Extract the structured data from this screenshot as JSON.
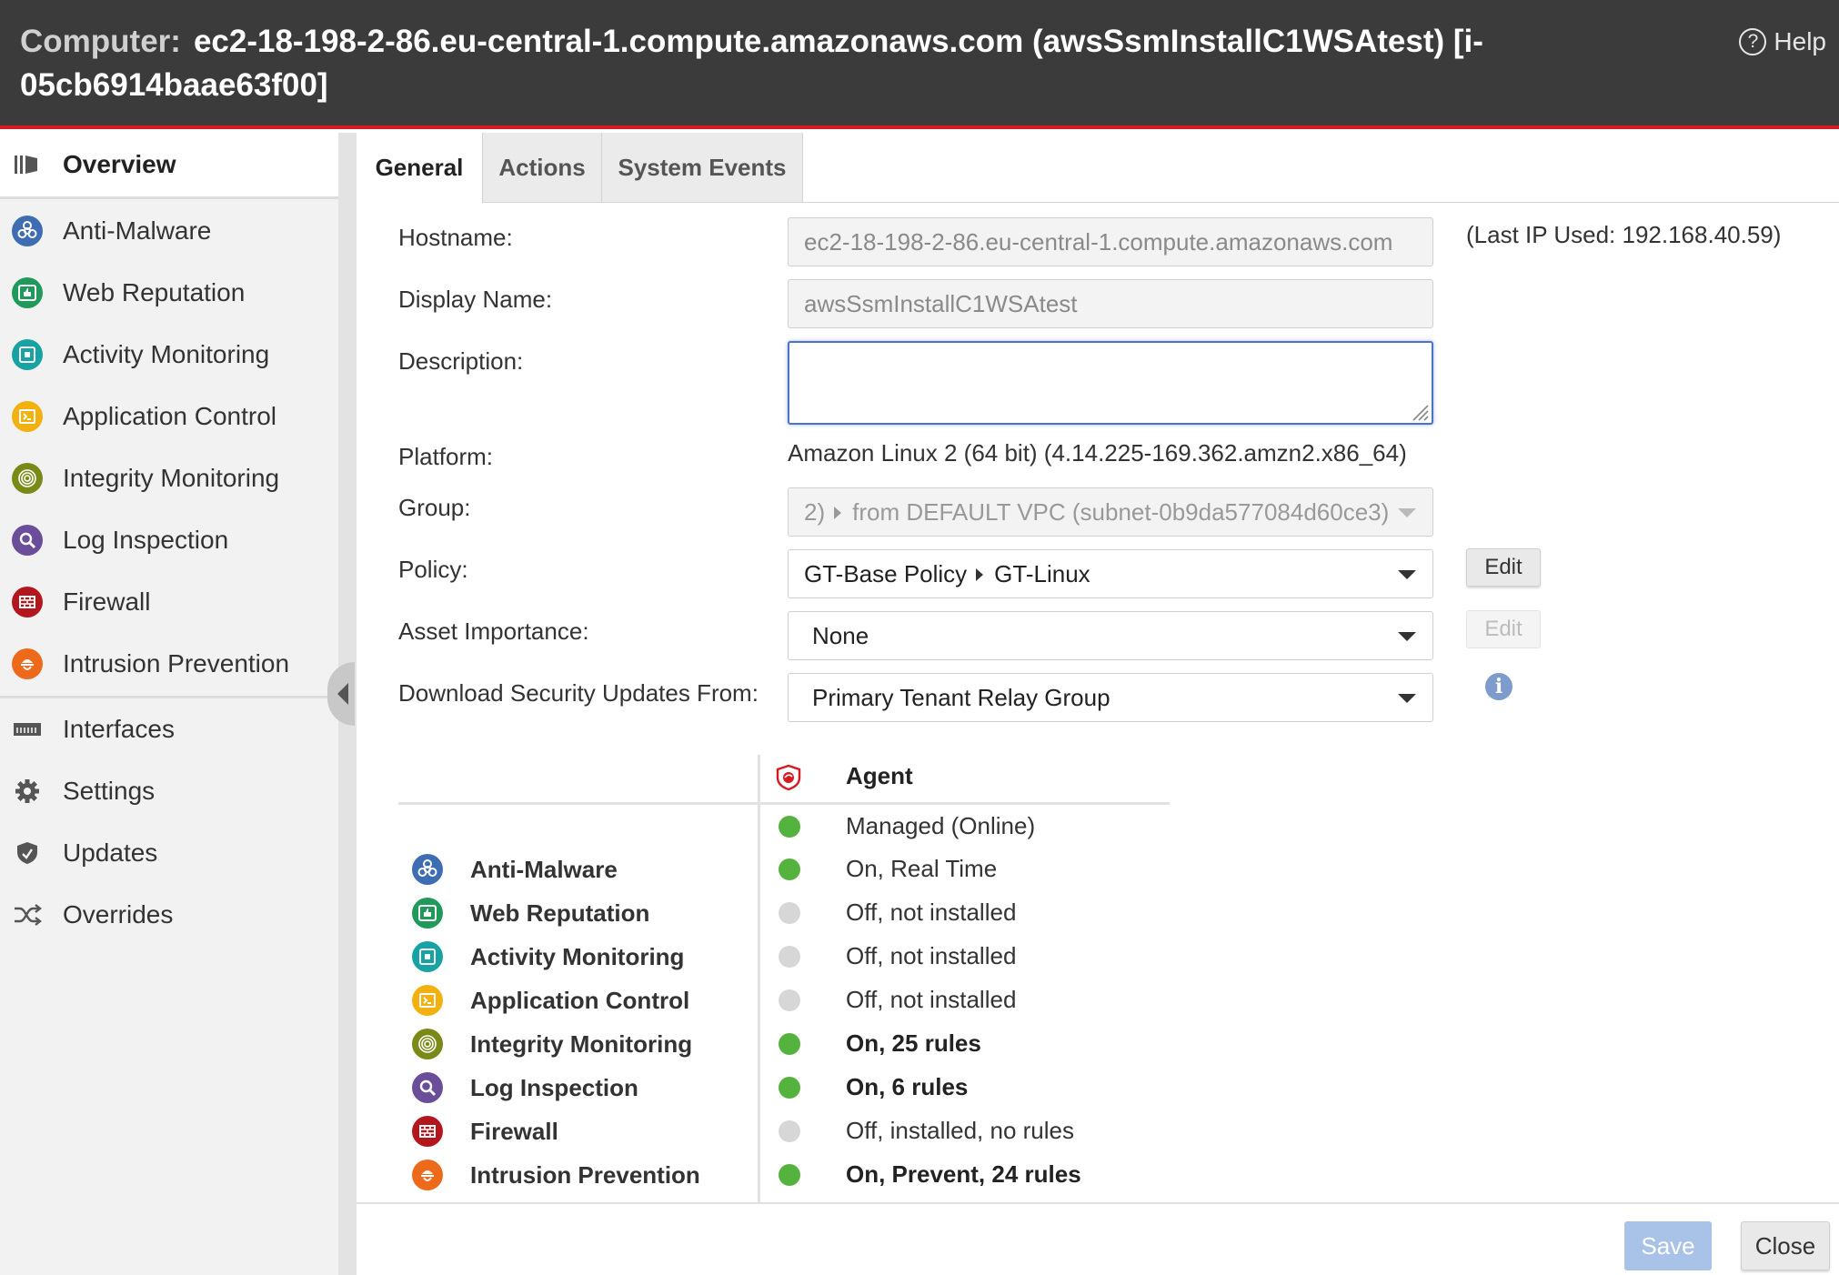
{
  "header": {
    "prefix": "Computer:",
    "title": "ec2-18-198-2-86.eu-central-1.compute.amazonaws.com (awsSsmInstallC1WSAtest) [i-05cb6914baae63f00]",
    "help_label": "Help"
  },
  "sidebar": {
    "items": [
      {
        "label": "Overview",
        "icon": "overview-icon"
      },
      {
        "label": "Anti-Malware",
        "icon": "biohazard-icon"
      },
      {
        "label": "Web Reputation",
        "icon": "web-reputation-icon"
      },
      {
        "label": "Activity Monitoring",
        "icon": "activity-monitoring-icon"
      },
      {
        "label": "Application Control",
        "icon": "terminal-icon"
      },
      {
        "label": "Integrity Monitoring",
        "icon": "fingerprint-icon"
      },
      {
        "label": "Log Inspection",
        "icon": "magnifier-icon"
      },
      {
        "label": "Firewall",
        "icon": "firewall-icon"
      },
      {
        "label": "Intrusion Prevention",
        "icon": "intrusion-prevention-icon"
      },
      {
        "label": "Interfaces",
        "icon": "ethernet-icon"
      },
      {
        "label": "Settings",
        "icon": "gear-icon"
      },
      {
        "label": "Updates",
        "icon": "shield-update-icon"
      },
      {
        "label": "Overrides",
        "icon": "shuffle-icon"
      }
    ]
  },
  "tabs": [
    {
      "label": "General"
    },
    {
      "label": "Actions"
    },
    {
      "label": "System Events"
    }
  ],
  "form": {
    "hostname_label": "Hostname:",
    "hostname_value": "ec2-18-198-2-86.eu-central-1.compute.amazonaws.com",
    "last_ip": "(Last IP Used: 192.168.40.59)",
    "display_name_label": "Display Name:",
    "display_name_value": "awsSsmInstallC1WSAtest",
    "description_label": "Description:",
    "description_value": "",
    "platform_label": "Platform:",
    "platform_value": "Amazon Linux 2 (64 bit) (4.14.225-169.362.amzn2.x86_64)",
    "group_label": "Group:",
    "group_prefix": "2)",
    "group_value": "from DEFAULT VPC (subnet-0b9da577084d60ce3)",
    "policy_label": "Policy:",
    "policy_parent": "GT-Base Policy",
    "policy_value": "GT-Linux",
    "policy_edit": "Edit",
    "asset_label": "Asset Importance:",
    "asset_value": "None",
    "asset_edit": "Edit",
    "download_label": "Download Security Updates From:",
    "download_value": "Primary Tenant Relay Group"
  },
  "status_table": {
    "agent_header": "Agent",
    "agent_status": "Managed (Online)",
    "modules": [
      {
        "name": "Anti-Malware",
        "status": "On, Real Time",
        "state": "green",
        "bold": false
      },
      {
        "name": "Web Reputation",
        "status": "Off, not installed",
        "state": "gray",
        "bold": false
      },
      {
        "name": "Activity Monitoring",
        "status": "Off, not installed",
        "state": "gray",
        "bold": false
      },
      {
        "name": "Application Control",
        "status": "Off, not installed",
        "state": "gray",
        "bold": false
      },
      {
        "name": "Integrity Monitoring",
        "status": "On, 25 rules",
        "state": "green",
        "bold": true
      },
      {
        "name": "Log Inspection",
        "status": "On, 6 rules",
        "state": "green",
        "bold": true
      },
      {
        "name": "Firewall",
        "status": "Off, installed, no rules",
        "state": "gray",
        "bold": false
      },
      {
        "name": "Intrusion Prevention",
        "status": "On, Prevent, 24 rules",
        "state": "green",
        "bold": true
      }
    ]
  },
  "footer": {
    "save_label": "Save",
    "close_label": "Close"
  },
  "colors": {
    "header_bg": "#3b3b3b",
    "accent_red": "#d71920",
    "status_green": "#54b33e",
    "status_gray": "#d7d7d7"
  }
}
